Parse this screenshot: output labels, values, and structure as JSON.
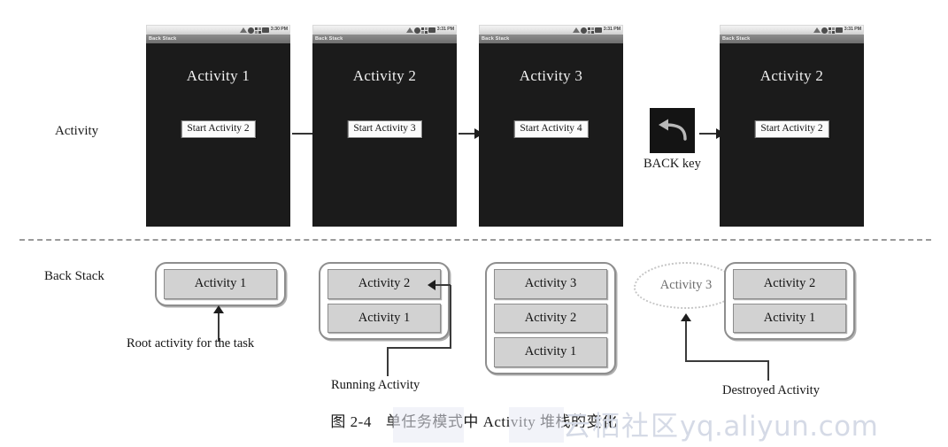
{
  "figure": {
    "caption_number": "图 2-4",
    "caption_text": "单任务模式中 Activity 堆栈的变化",
    "watermark_cn": "云栖社区",
    "watermark_url": "yq.aliyun.com"
  },
  "row_labels": {
    "activity": "Activity",
    "back_stack": "Back Stack"
  },
  "phones": [
    {
      "title_bar": "Back Stack",
      "status_time": "3:30 PM",
      "activity_title": "Activity 1",
      "button_label": "Start Activity 2"
    },
    {
      "title_bar": "Back Stack",
      "status_time": "3:31 PM",
      "activity_title": "Activity 2",
      "button_label": "Start Activity 3"
    },
    {
      "title_bar": "Back Stack",
      "status_time": "3:31 PM",
      "activity_title": "Activity 3",
      "button_label": "Start Activity 4"
    },
    {
      "title_bar": "Back Stack",
      "status_time": "3:31 PM",
      "activity_title": "Activity 2",
      "button_label": "Start Activity 2"
    }
  ],
  "back_key": {
    "label": "BACK key",
    "icon": "back-arrow-icon"
  },
  "stacks": [
    {
      "items": [
        "Activity 1"
      ]
    },
    {
      "items": [
        "Activity 2",
        "Activity 1"
      ]
    },
    {
      "items": [
        "Activity 3",
        "Activity 2",
        "Activity 1"
      ]
    },
    {
      "items": [
        "Activity 2",
        "Activity 1"
      ]
    }
  ],
  "ghost_activity": {
    "label": "Activity 3"
  },
  "annotations": {
    "root_activity": "Root activity for the task",
    "running_activity": "Running Activity",
    "destroyed_activity": "Destroyed Activity"
  },
  "colors": {
    "screen_bg": "#1b1b1b",
    "stack_item_fill": "#d2d2d2",
    "stack_border": "#8e8e8e",
    "watermark": "#d5dae6"
  }
}
